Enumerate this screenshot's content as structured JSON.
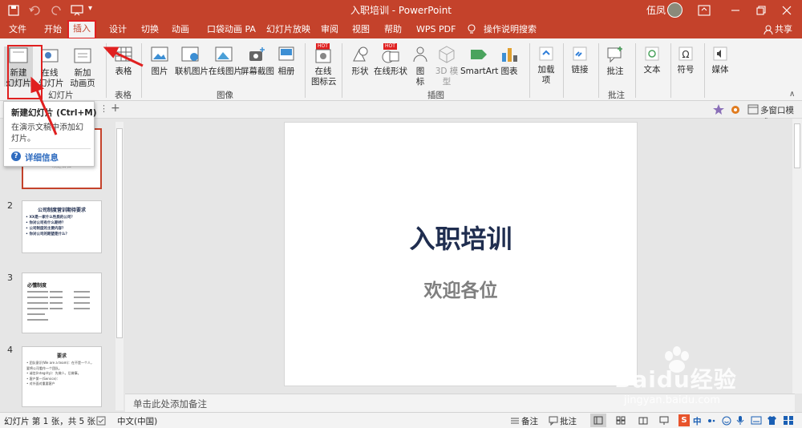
{
  "window": {
    "title": "入职培训 - PowerPoint",
    "user": "伍凤",
    "share": "共享"
  },
  "tabs": [
    "文件",
    "开始",
    "插入",
    "设计",
    "切换",
    "动画",
    "口袋动画 PA",
    "幻灯片放映",
    "审阅",
    "视图",
    "帮助",
    "WPS PDF",
    "操作说明搜索"
  ],
  "ribbon": {
    "new_slide": [
      "新建",
      "幻灯片"
    ],
    "online_slide": [
      "在线",
      "幻灯片"
    ],
    "add_anim_page": [
      "新加",
      "动画页"
    ],
    "table": "表格",
    "picture": "图片",
    "online_gallery": "联机图片",
    "online_picture": "在线图片",
    "screenshot": "屏幕截图",
    "album": "相册",
    "online_icon_cloud": [
      "在线",
      "图标云"
    ],
    "shapes": "形状",
    "online_shapes": "在线形状",
    "icons": [
      "图",
      "标"
    ],
    "model3d": [
      "3D 模",
      "型"
    ],
    "smartart": "SmartArt",
    "chart": "图表",
    "addins": [
      "加载",
      "项"
    ],
    "link": "链接",
    "comment": "批注",
    "text": "文本",
    "symbol": "符号",
    "media": "媒体",
    "groups": {
      "slides": "幻灯片",
      "tables": "表格",
      "images": "图像",
      "illustrations": "插图",
      "comments": "批注"
    },
    "hot_badge": "HOT"
  },
  "tooltip": {
    "title": "新建幻灯片 (Ctrl+M)",
    "desc": "在演示文稿中添加幻灯片。",
    "more": "详细信息"
  },
  "toolbar_right": {
    "multi_window": "多窗口模式"
  },
  "thumbnails": [
    {
      "num": "1",
      "text": "欢迎各位"
    },
    {
      "num": "2",
      "title": "公司制度营训期待要求",
      "lines": [
        "• XX是一家什么性质的公司？",
        "• 你对公司有什么期待？",
        "• 公司制度的主要内容？",
        "• 你对公司的期望是什么？"
      ]
    },
    {
      "num": "3",
      "title": "必懂制度"
    },
    {
      "num": "4",
      "title": "要求",
      "lines": [
        "• 团队意识(We are a team)：在不是一个人，要将公司看作一个团队。",
        "• 诚信(Integrity)：先做人，后做事。",
        "• 客户第一(Service)：",
        "• 对外面对重要客户"
      ]
    }
  ],
  "slide": {
    "title": "入职培训",
    "subtitle": "欢迎各位"
  },
  "notes": {
    "placeholder": "单击此处添加备注"
  },
  "status": {
    "slide_info": "幻灯片 第 1 张，共 5 张",
    "language": "中文(中国)",
    "notes": "备注",
    "comments": "批注",
    "ime": "中"
  },
  "watermark": {
    "brand": "Baidu经验",
    "url": "jingyan.baidu.com"
  },
  "colors": {
    "accent": "#c4422b",
    "highlight": "#e02020",
    "slide_title": "#1f2d4f",
    "slide_subtitle": "#7f7f7f"
  }
}
